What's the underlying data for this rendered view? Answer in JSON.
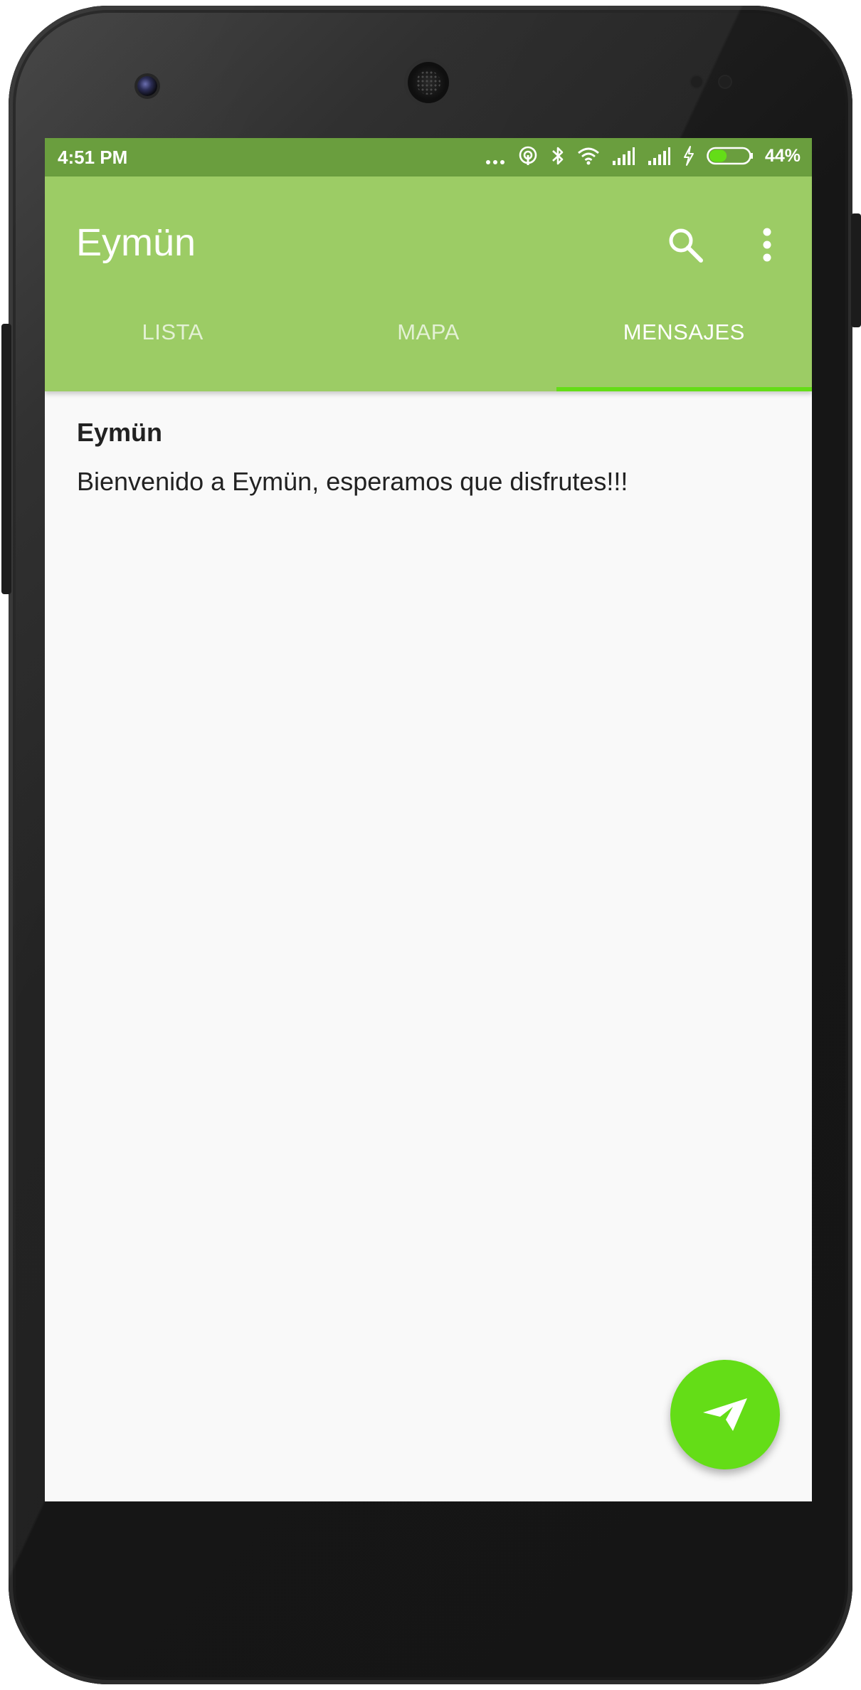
{
  "status_bar": {
    "time": "4:51 PM",
    "icons": [
      "more-dots-icon",
      "hotspot-icon",
      "bluetooth-icon",
      "wifi-icon",
      "signal-icon",
      "signal-icon",
      "charging-icon",
      "battery-icon"
    ],
    "battery_level": 0.44,
    "battery_percent": "44%"
  },
  "app_bar": {
    "title": "Eymün",
    "actions": [
      "search-icon",
      "overflow-menu-icon"
    ],
    "color": "#9ccc65"
  },
  "tabs": [
    {
      "label": "LISTA",
      "active": false
    },
    {
      "label": "MAPA",
      "active": false
    },
    {
      "label": "MENSAJES",
      "active": true
    }
  ],
  "message": {
    "title": "Eymün",
    "body": "Bienvenido a Eymün, esperamos que disfrutes!!!"
  },
  "fab": {
    "icon": "send-icon",
    "color": "#64dd17"
  }
}
